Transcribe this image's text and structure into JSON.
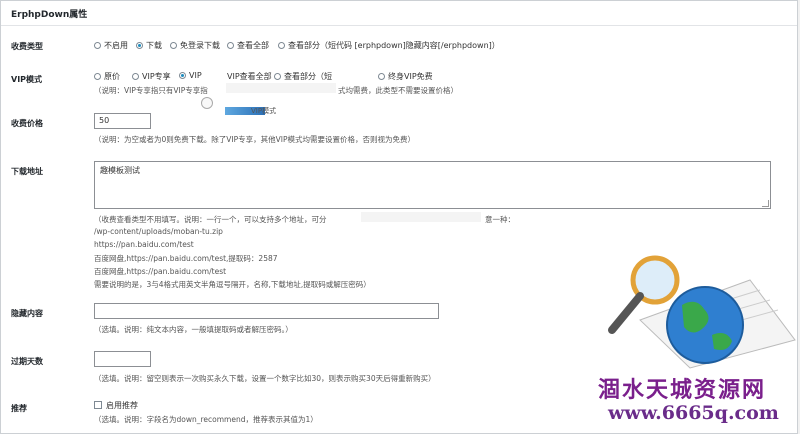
{
  "panel": {
    "title": "ErphpDown属性"
  },
  "fee_type": {
    "label": "收费类型",
    "options": [
      "不启用",
      "下载",
      "免登录下载",
      "查看全部",
      "查看部分（短代码 [erphpdown]隐藏内容[/erphpdown]）"
    ],
    "selected_index": 1
  },
  "vip_mode": {
    "label": "VIP模式",
    "options": [
      "原价",
      "VIP专享",
      "VIP",
      "VIP查看全部",
      "查看部分（短",
      "终身VIP免费"
    ],
    "selected_index": 2,
    "hint": "（说明：VIP专享指只有VIP专享指",
    "hint_tail": "式均需费，此类型不需要设置价格）",
    "tooltip_text": "VIP模式"
  },
  "price": {
    "label": "收费价格",
    "value": "50",
    "hint": "（说明：为空或者为0则免费下载。除了VIP专享，其他VIP模式均需要设置价格，否则视为免费）"
  },
  "download": {
    "label": "下载地址",
    "value": "趣模板测试",
    "hint_lines": [
      "（收费查看类型不用填写。说明：一行一个，可以支持多个地址，可分",
      "/wp-content/uploads/moban-tu.zip",
      "https://pan.baidu.com/test",
      "百度网盘,https://pan.baidu.com/test,提取码：2587",
      "百度网盘,https://pan.baidu.com/test",
      "需要说明的是，3与4格式用英文半角逗号隔开，名称,下载地址,提取码或解压密码）"
    ],
    "hint_tail": "意一种："
  },
  "hidden": {
    "label": "隐藏内容",
    "value": "",
    "hint": "（选填。说明：纯文本内容，一般填提取码或者解压密码。）"
  },
  "expire": {
    "label": "过期天数",
    "value": "",
    "hint": "（选填。说明：留空则表示一次购买永久下载，设置一个数字比如30，则表示购买30天后得重新购买）"
  },
  "recommend": {
    "label": "推荐",
    "checkbox_label": "启用推荐",
    "checked": false,
    "hint": "（选填。说明：字段名为down_recommend，推荐表示其值为1）"
  },
  "watermark": {
    "text": "涸水天城资源网",
    "url": "www.6665q.com",
    "icon": "magnifier-globe-icon"
  },
  "colors": {
    "accent": "#1e8cbe",
    "watermark": "#7a1f8c"
  }
}
